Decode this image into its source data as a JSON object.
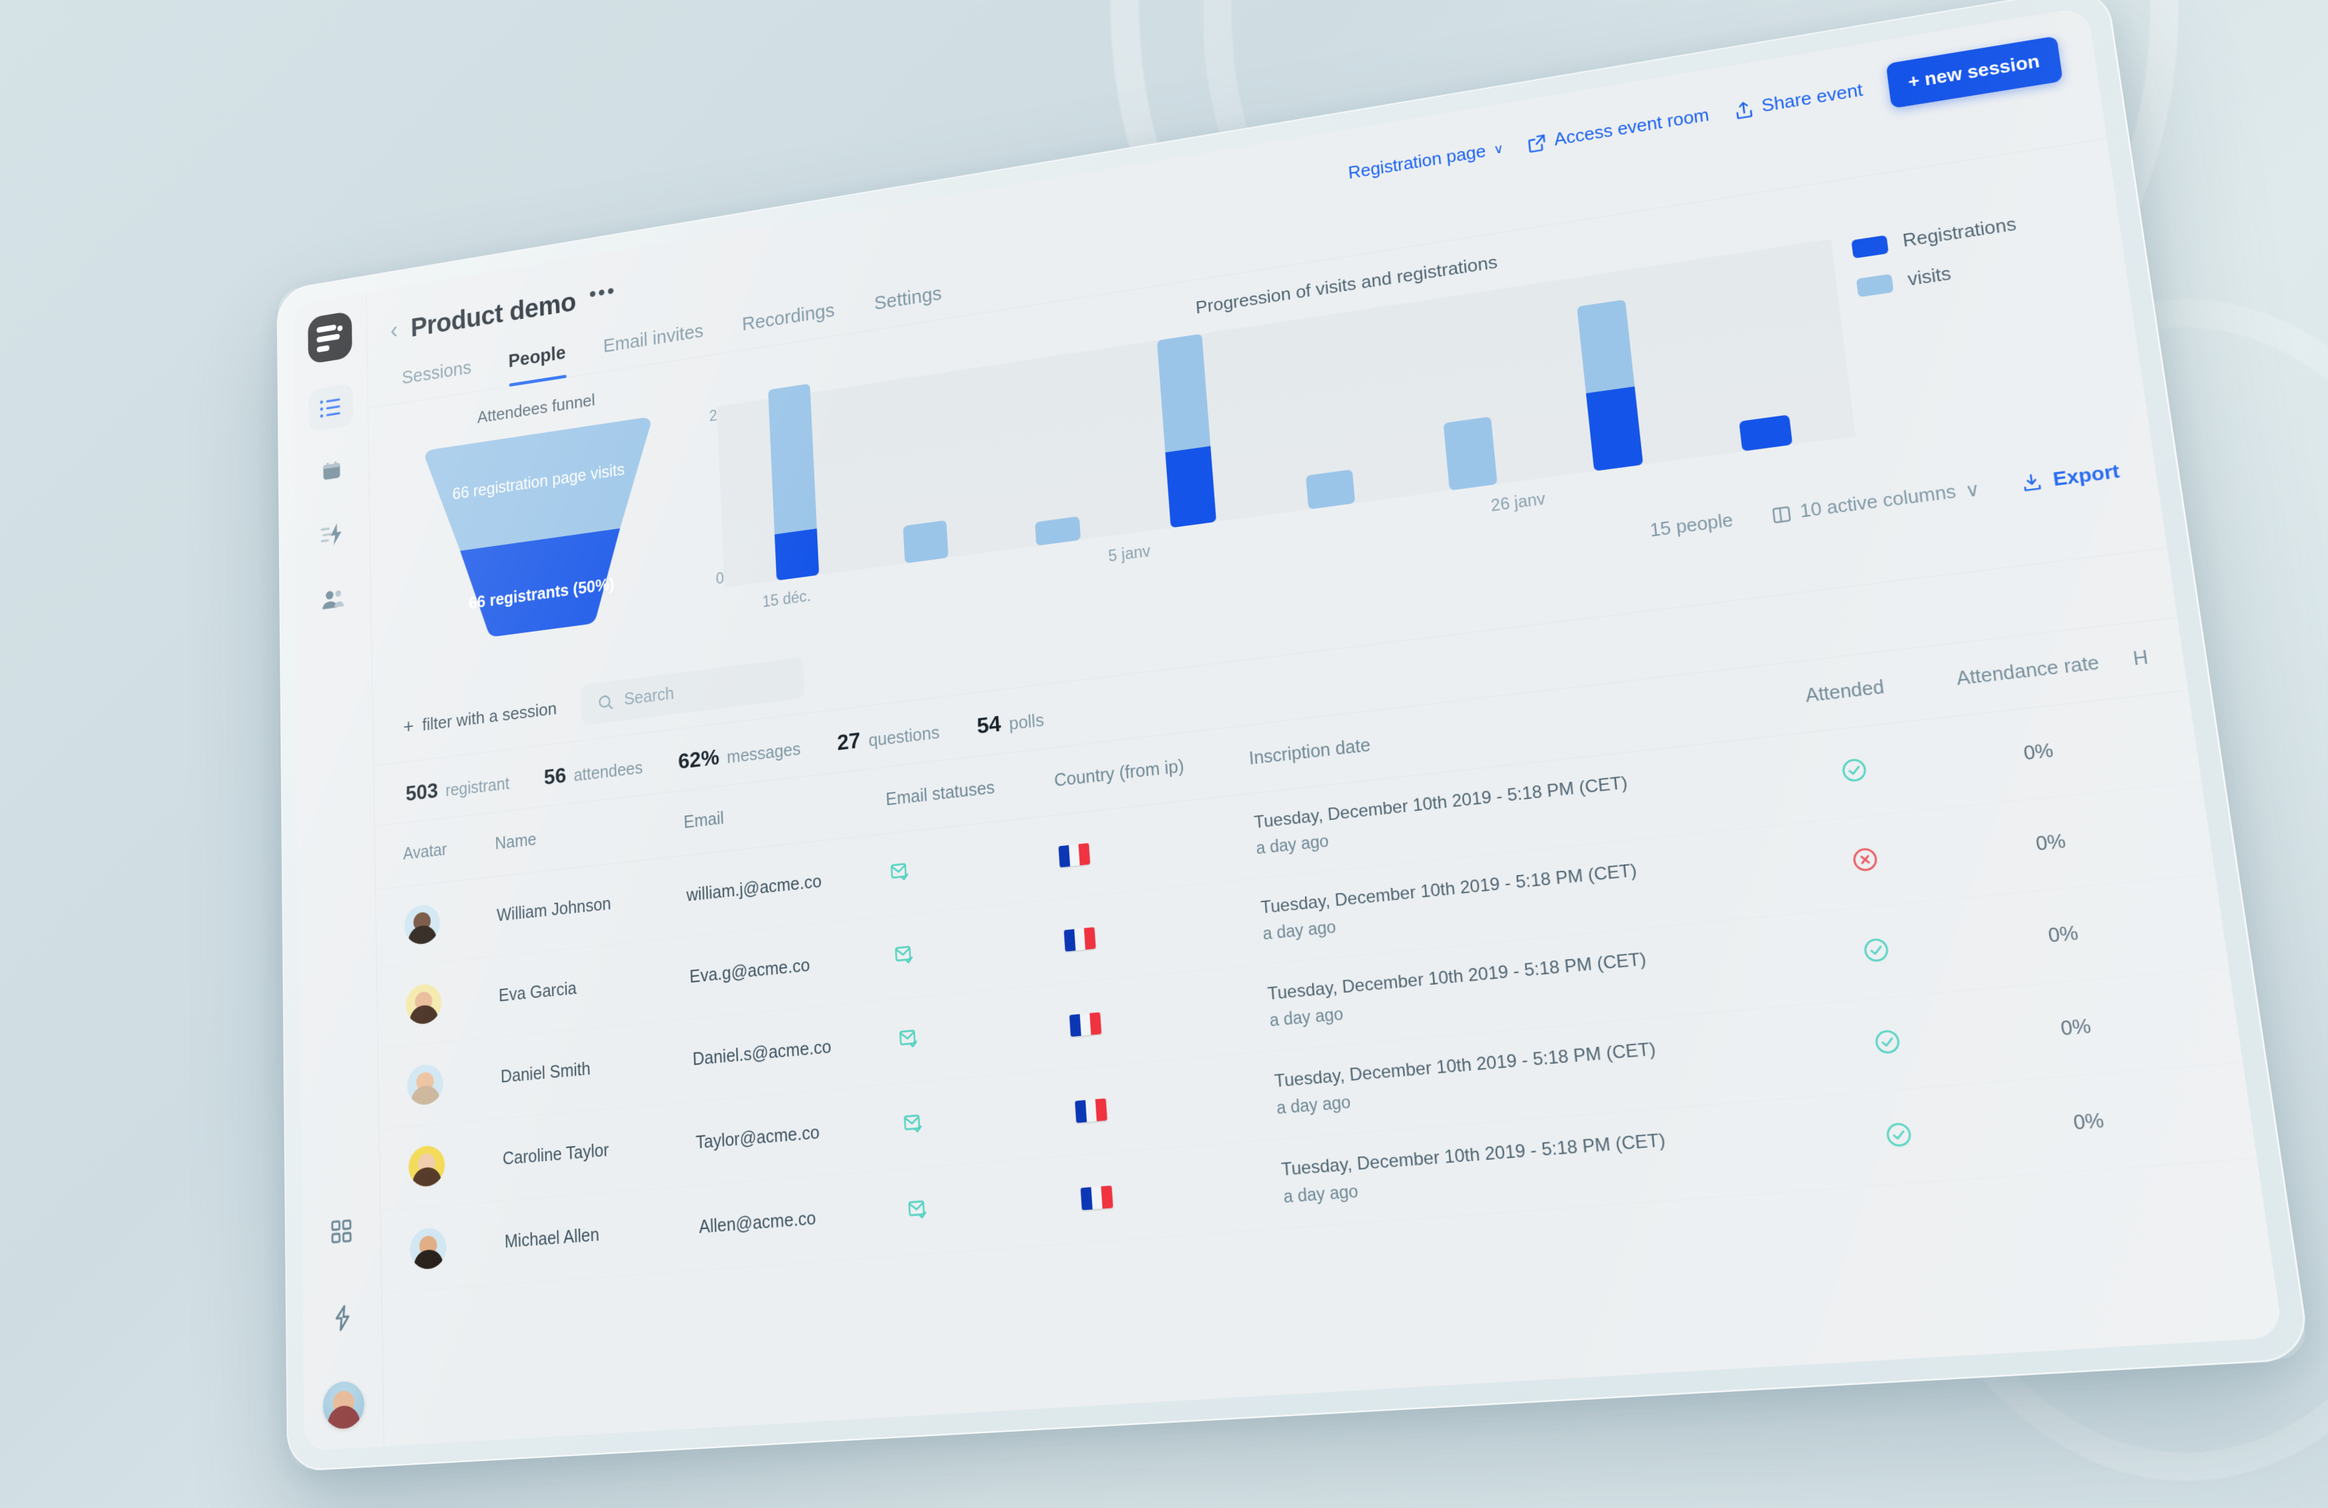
{
  "colors": {
    "accent": "#1454e8",
    "accent_link": "#1a62f2",
    "visits": "#9bc5e8",
    "registrations": "#1454e8",
    "success": "#4fd1c0",
    "danger": "#e8535c",
    "muted": "#7e97a5"
  },
  "sidebar": {
    "logo_name": "logo-mark",
    "items": [
      {
        "name": "sidebar-item-sessions",
        "icon": "list-icon",
        "active": true
      },
      {
        "name": "sidebar-item-calendar",
        "icon": "calendar-icon",
        "active": false
      },
      {
        "name": "sidebar-item-automation",
        "icon": "lightning-lines-icon",
        "active": false
      },
      {
        "name": "sidebar-item-people",
        "icon": "people-icon",
        "active": false
      }
    ],
    "bottom_items": [
      {
        "name": "sidebar-item-apps",
        "icon": "grid-icon"
      },
      {
        "name": "sidebar-item-integrations",
        "icon": "lightning-icon"
      }
    ],
    "avatar_name": "user-avatar"
  },
  "header": {
    "back_label": "‹",
    "title": "Product demo",
    "more_label": "•••",
    "registration_page": "Registration page",
    "registration_chevron": "∨",
    "access_event_room": "Access event room",
    "share_event": "Share event",
    "new_session": "+ new session"
  },
  "tabs": [
    {
      "label": "Sessions",
      "active": false
    },
    {
      "label": "People",
      "active": true
    },
    {
      "label": "Email invites",
      "active": false
    },
    {
      "label": "Recordings",
      "active": false
    },
    {
      "label": "Settings",
      "active": false
    }
  ],
  "funnel": {
    "title": "Attendees funnel",
    "top_label": "66 registration page visits",
    "bottom_label": "66 registrants (50%)"
  },
  "chart_data": {
    "type": "bar",
    "title": "Progression of visits and registrations",
    "xlabel": "",
    "ylabel": "",
    "ylim": [
      0,
      2
    ],
    "yticks": [
      "0",
      "2"
    ],
    "grid": false,
    "legend_position": "right",
    "stacked": true,
    "categories": [
      "15 déc.",
      "",
      "",
      "5 janv",
      "",
      "",
      "26 janv",
      ""
    ],
    "tick_labels": [
      {
        "label": "15 déc.",
        "index": 0
      },
      {
        "label": "5 janv",
        "index": 3
      },
      {
        "label": "26 janv",
        "index": 6
      }
    ],
    "series": [
      {
        "name": "Registrations",
        "color": "#1454e8",
        "values": [
          0.5,
          0,
          0,
          0.8,
          0,
          0,
          0.8,
          0.3
        ]
      },
      {
        "name": "visits",
        "color": "#9bc5e8",
        "values": [
          1.6,
          0.4,
          0.25,
          1.2,
          0.35,
          0.7,
          0.9,
          0
        ]
      }
    ],
    "legend": [
      {
        "label": "Registrations",
        "color": "#1454e8"
      },
      {
        "label": "visits",
        "color": "#9bc5e8"
      }
    ]
  },
  "toolbar": {
    "people_count": "15 people",
    "active_columns": "10 active columns",
    "columns_chevron": "∨",
    "export": "Export"
  },
  "filters": {
    "add_filter": "filter with a session",
    "plus": "+",
    "search_placeholder": "Search",
    "search_value": ""
  },
  "stats": [
    {
      "value": "503",
      "label": "registrant"
    },
    {
      "value": "56",
      "label": "attendees"
    },
    {
      "value": "62%",
      "label": "messages"
    },
    {
      "value": "27",
      "label": "questions"
    },
    {
      "value": "54",
      "label": "polls"
    }
  ],
  "table": {
    "columns": [
      "Avatar",
      "Name",
      "Email",
      "Email statuses",
      "Country (from ip)",
      "Inscription date",
      "Attended",
      "Attendance rate"
    ],
    "more_column": "H",
    "rows": [
      {
        "name": "William Johnson",
        "email": "william.j@acme.co",
        "email_status": "mail-check-icon",
        "country": "fr",
        "date": "Tuesday, December 10th 2019 - 5:18 PM (CET)",
        "relative": "a day ago",
        "attended": "check",
        "attendance_rate": "0%",
        "avatar_skin": "#6d4834",
        "avatar_hair": "#20160f",
        "avatar_bg": "#cfe6f2"
      },
      {
        "name": "Eva Garcia",
        "email": "Eva.g@acme.co",
        "email_status": "mail-check-icon",
        "country": "fr",
        "date": "Tuesday, December 10th 2019 - 5:18 PM (CET)",
        "relative": "a day ago",
        "attended": "cross",
        "attendance_rate": "0%",
        "avatar_skin": "#e8b894",
        "avatar_hair": "#3c2416",
        "avatar_bg": "#f4e9a8"
      },
      {
        "name": "Daniel Smith",
        "email": "Daniel.s@acme.co",
        "email_status": "mail-check-icon",
        "country": "fr",
        "date": "Tuesday, December 10th 2019 - 5:18 PM (CET)",
        "relative": "a day ago",
        "attended": "check",
        "attendance_rate": "0%",
        "avatar_skin": "#ecc09c",
        "avatar_hair": "#c9b195",
        "avatar_bg": "#cfe6f2"
      },
      {
        "name": "Caroline Taylor",
        "email": "Taylor@acme.co",
        "email_status": "mail-check-icon",
        "country": "fr",
        "date": "Tuesday, December 10th 2019 - 5:18 PM (CET)",
        "relative": "a day ago",
        "attended": "check",
        "attendance_rate": "0%",
        "avatar_skin": "#f0cba8",
        "avatar_hair": "#4a2d1b",
        "avatar_bg": "#f2d94e"
      },
      {
        "name": "Michael Allen",
        "email": "Allen@acme.co",
        "email_status": "mail-check-icon",
        "country": "fr",
        "date": "Tuesday, December 10th 2019 - 5:18 PM (CET)",
        "relative": "a day ago",
        "attended": "check",
        "attendance_rate": "0%",
        "avatar_skin": "#e0a97e",
        "avatar_hair": "#1d1510",
        "avatar_bg": "#cfe6f2"
      }
    ]
  }
}
